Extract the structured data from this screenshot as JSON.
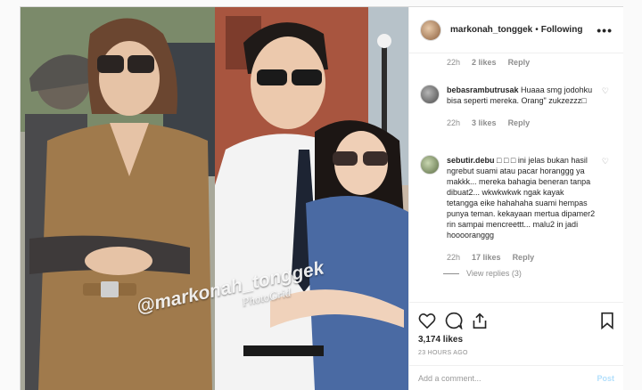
{
  "header": {
    "username": "markonah_tonggek",
    "separator": "•",
    "follow_status": "Following",
    "more_glyph": "•••"
  },
  "photo": {
    "watermark_text": "@markonah_tonggek",
    "watermark_sub": "PhotoGrid"
  },
  "comments": [
    {
      "username": "",
      "text": "",
      "time": "22h",
      "likes": "2 likes",
      "reply": "Reply"
    },
    {
      "username": "bebasrambutrusak",
      "text": "Huaaa smg jodohku bisa seperti mereka. Orang\" zukzezzz□",
      "time": "22h",
      "likes": "3 likes",
      "reply": "Reply"
    },
    {
      "username": "sebutir.debu",
      "text": "□ □ □ ini jelas bukan hasil ngrebut suami atau pacar horanggg ya makkk... mereka bahagia beneran tanpa dibuat2... wkwkwkwk ngak kayak tetangga eike hahahaha suami hempas punya teman. kekayaan mertua dipamer2 rin sampai mencreettt... malu2 in jadi hooooranggg",
      "time": "22h",
      "likes": "17 likes",
      "reply": "Reply",
      "view_replies": "View replies (3)"
    }
  ],
  "actions": {
    "likes": "3,174 likes",
    "timestamp": "23 HOURS AGO",
    "comment_placeholder": "Add a comment...",
    "post_label": "Post"
  },
  "colors": {
    "text": "#262626",
    "muted": "#8e8e8e",
    "post_disabled": "#b2dffc",
    "border": "#efefef"
  }
}
